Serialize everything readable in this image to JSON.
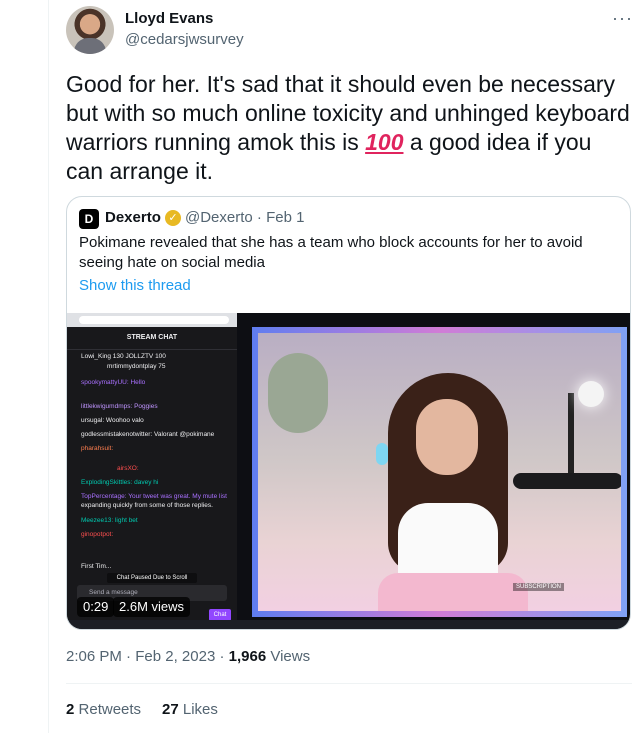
{
  "author": {
    "name": "Lloyd Evans",
    "handle": "@cedarsjwsurvey"
  },
  "more_menu": "···",
  "tweet": {
    "text_part1": "Good for her. It's sad that it should even be necessary but with so much online toxicity and unhinged keyboard warriors running amok this is ",
    "emoji": "100",
    "text_part2": " a good idea if you can arrange it."
  },
  "quote": {
    "logo": "D",
    "name": "Dexerto",
    "handle": "@Dexerto",
    "separator": "·",
    "date": "Feb 1",
    "text": "Pokimane revealed that she has a team who block accounts for her to avoid seeing hate on social media",
    "show_thread": "Show this thread",
    "media": {
      "chat_header": "STREAM CHAT",
      "chat_lines": [
        "Lowi_King  130   JOLLZTV  100",
        "mrtimmydontplay  75",
        "spookymattyUU: Hello",
        "littlekwigumdmps: Poggies",
        "ursugal: Woohoo valo",
        "godlessmistakenotwitter: Valorant @pokimane",
        "pharahsuit:",
        "airsXO:",
        "ExplodingSkittles: davey hi",
        "TopPercentage: Your tweet was great. My mute list",
        "expanding quickly from some of those replies.",
        "Meezee13: light bet",
        "ginopotpot:",
        "First Tim..."
      ],
      "paused": "Chat Paused Due to Scroll",
      "send_placeholder": "Send a message",
      "chat_button": "Chat",
      "subscribe_badge": "SUBSCRIPTION",
      "time": "0:29",
      "views": "2.6M views"
    }
  },
  "footer": {
    "time": "2:06 PM",
    "separator": "·",
    "date": "Feb 2, 2023",
    "separator2": "·",
    "views_count": "1,966",
    "views_label": "Views"
  },
  "stats": {
    "retweets_count": "2",
    "retweets_label": "Retweets",
    "likes_count": "27",
    "likes_label": "Likes"
  },
  "colors": {
    "link": "#1d9bf0",
    "secondary_text": "#536471",
    "verified_badge": "#e8b923",
    "twitch_purple": "#9147ff"
  }
}
